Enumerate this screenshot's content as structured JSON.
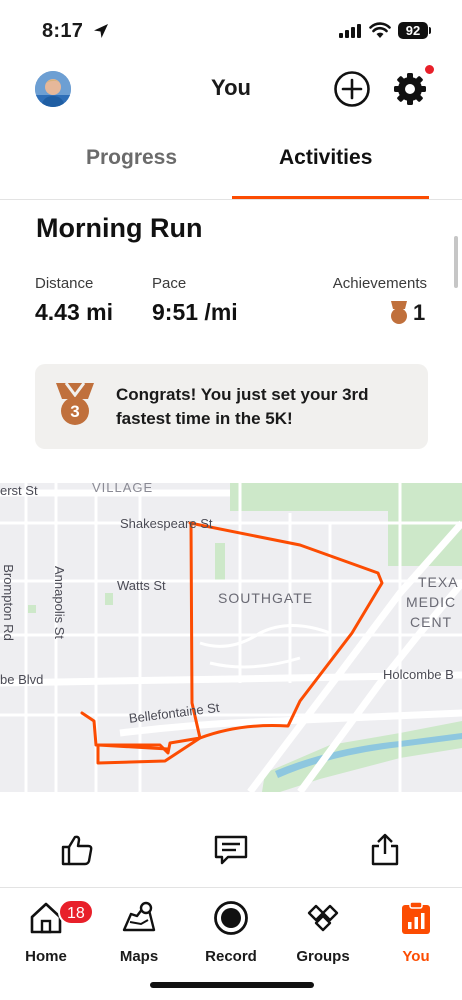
{
  "status_bar": {
    "time": "8:17",
    "battery": "92",
    "icons": [
      "location-arrow-icon",
      "signal-icon",
      "wifi-icon",
      "battery-icon"
    ]
  },
  "header": {
    "title": "You",
    "avatar": "user-avatar",
    "add_icon": "plus-circle-icon",
    "settings_icon": "gear-icon",
    "notification_dot": true
  },
  "tabs": [
    {
      "label": "Progress",
      "active": false
    },
    {
      "label": "Activities",
      "active": true
    }
  ],
  "activity": {
    "title": "Morning Run",
    "stats": {
      "distance": {
        "label": "Distance",
        "value": "4.43 mi"
      },
      "pace": {
        "label": "Pace",
        "value": "9:51 /mi"
      },
      "achievements": {
        "label": "Achievements",
        "value": "1"
      }
    },
    "congrats": "Congrats! You just set your 3rd fastest time in the 5K!",
    "medal_number": "3"
  },
  "map": {
    "labels": {
      "village": "VILLAGE",
      "erst_st": "erst St",
      "shakespeare": "Shakespeare St",
      "watts": "Watts St",
      "southgate": "SOUTHGATE",
      "brompton": "Brompton Rd",
      "annapolis": "Annapolis St",
      "texas": "TEXA",
      "medic": "MEDIC",
      "cent": "CENT",
      "be_blvd": "be Blvd",
      "holcombe": "Holcombe B",
      "bellefontaine": "Bellefontaine St"
    },
    "route_color": "#fc4c02"
  },
  "actions": {
    "kudos": "thumbs-up-icon",
    "comment": "comment-icon",
    "share": "share-icon"
  },
  "bottom_nav": [
    {
      "label": "Home",
      "icon": "home-icon",
      "badge": "18",
      "active": false
    },
    {
      "label": "Maps",
      "icon": "maps-icon",
      "active": false
    },
    {
      "label": "Record",
      "icon": "record-icon",
      "active": false
    },
    {
      "label": "Groups",
      "icon": "groups-icon",
      "active": false
    },
    {
      "label": "You",
      "icon": "you-icon",
      "active": true
    }
  ],
  "colors": {
    "accent": "#fc4c02",
    "badge": "#e8202a",
    "bronze": "#c0703c"
  }
}
